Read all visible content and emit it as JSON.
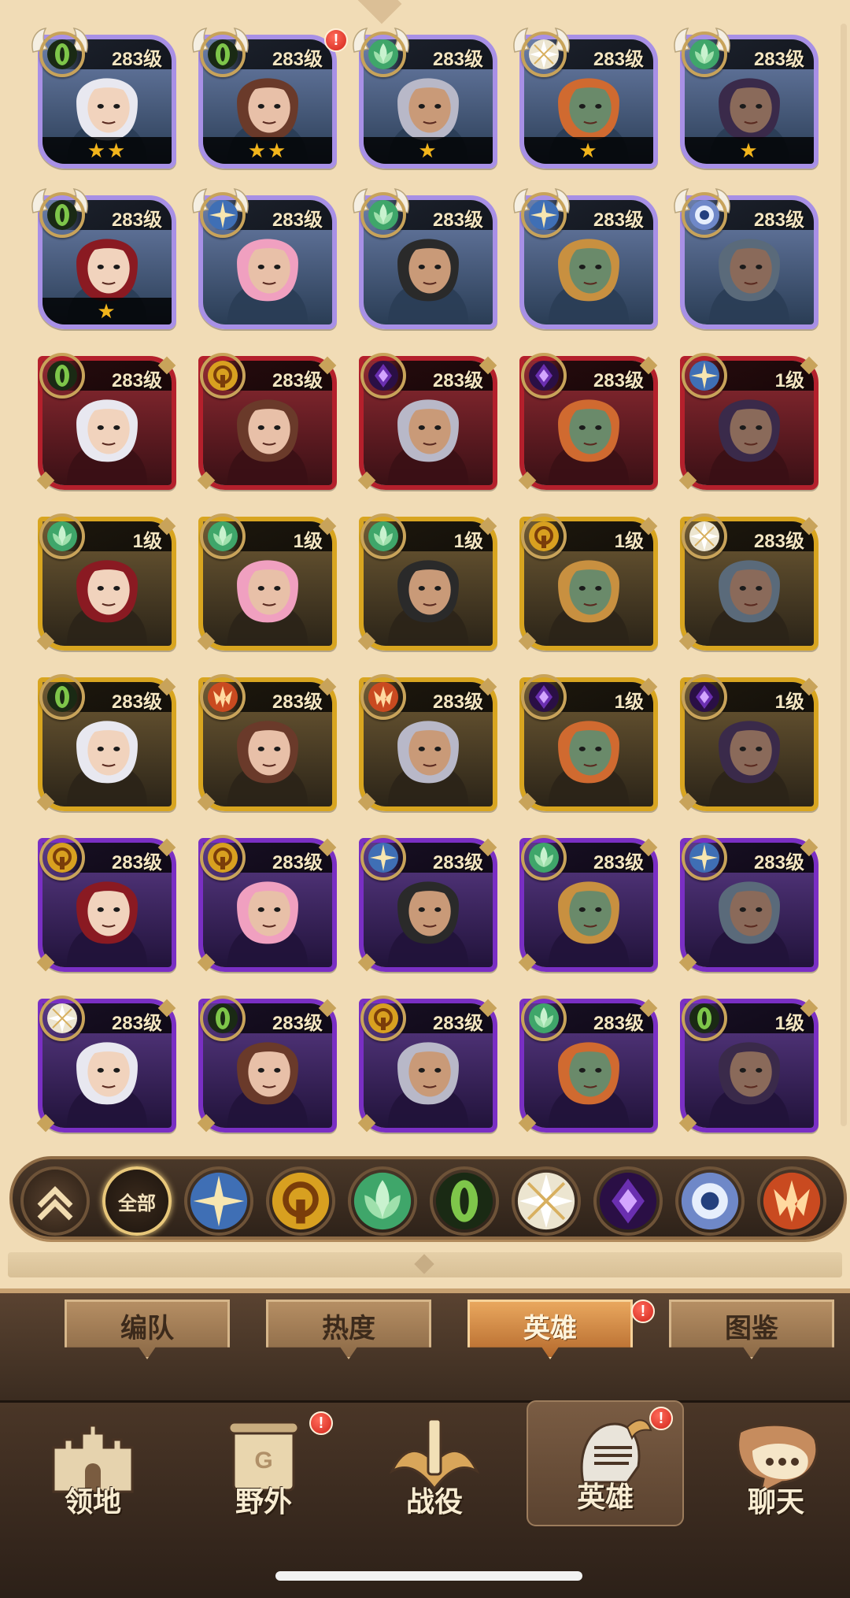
{
  "heroes": [
    {
      "level": "283级",
      "faction": "graveborn",
      "tier": "purple",
      "stars": "★★",
      "wings": true,
      "alert": false
    },
    {
      "level": "283级",
      "faction": "graveborn",
      "tier": "purple",
      "stars": "★★",
      "wings": true,
      "alert": true
    },
    {
      "level": "283级",
      "faction": "wilder",
      "tier": "purple",
      "stars": "★",
      "wings": true,
      "alert": false
    },
    {
      "level": "283级",
      "faction": "celestial",
      "tier": "purple",
      "stars": "★",
      "wings": true,
      "alert": false
    },
    {
      "level": "283级",
      "faction": "wilder",
      "tier": "purple",
      "stars": "★",
      "wings": true,
      "alert": false
    },
    {
      "level": "283级",
      "faction": "graveborn",
      "tier": "purple",
      "stars": "★",
      "wings": true,
      "alert": false
    },
    {
      "level": "283级",
      "faction": "lightbearer",
      "tier": "purple",
      "stars": "",
      "wings": true,
      "alert": false
    },
    {
      "level": "283级",
      "faction": "wilder",
      "tier": "purple",
      "stars": "",
      "wings": true,
      "alert": false
    },
    {
      "level": "283级",
      "faction": "lightbearer",
      "tier": "purple",
      "stars": "",
      "wings": true,
      "alert": false
    },
    {
      "level": "283级",
      "faction": "dimensional",
      "tier": "purple",
      "stars": "",
      "wings": true,
      "alert": false
    },
    {
      "level": "283级",
      "faction": "graveborn",
      "tier": "red",
      "stars": "",
      "wings": false,
      "alert": false
    },
    {
      "level": "283级",
      "faction": "mauler",
      "tier": "red",
      "stars": "",
      "wings": false,
      "alert": false
    },
    {
      "level": "283级",
      "faction": "hypogean",
      "tier": "red",
      "stars": "",
      "wings": false,
      "alert": false
    },
    {
      "level": "283级",
      "faction": "hypogean",
      "tier": "red",
      "stars": "",
      "wings": false,
      "alert": false
    },
    {
      "level": "1级",
      "faction": "lightbearer",
      "tier": "red",
      "stars": "",
      "wings": false,
      "alert": false
    },
    {
      "level": "1级",
      "faction": "wilder",
      "tier": "gold",
      "stars": "",
      "wings": false,
      "alert": false
    },
    {
      "level": "1级",
      "faction": "wilder",
      "tier": "gold",
      "stars": "",
      "wings": false,
      "alert": false
    },
    {
      "level": "1级",
      "faction": "wilder",
      "tier": "gold",
      "stars": "",
      "wings": false,
      "alert": false
    },
    {
      "level": "1级",
      "faction": "mauler",
      "tier": "gold",
      "stars": "",
      "wings": false,
      "alert": false
    },
    {
      "level": "283级",
      "faction": "celestial",
      "tier": "gold",
      "stars": "",
      "wings": false,
      "alert": false
    },
    {
      "level": "283级",
      "faction": "graveborn",
      "tier": "gold",
      "stars": "",
      "wings": false,
      "alert": false
    },
    {
      "level": "283级",
      "faction": "draconis",
      "tier": "gold",
      "stars": "",
      "wings": false,
      "alert": false
    },
    {
      "level": "283级",
      "faction": "draconis",
      "tier": "gold",
      "stars": "",
      "wings": false,
      "alert": false
    },
    {
      "level": "1级",
      "faction": "hypogean",
      "tier": "gold",
      "stars": "",
      "wings": false,
      "alert": false
    },
    {
      "level": "1级",
      "faction": "hypogean",
      "tier": "gold",
      "stars": "",
      "wings": false,
      "alert": false
    },
    {
      "level": "283级",
      "faction": "mauler",
      "tier": "violet",
      "stars": "",
      "wings": false,
      "alert": false
    },
    {
      "level": "283级",
      "faction": "mauler",
      "tier": "violet",
      "stars": "",
      "wings": false,
      "alert": false
    },
    {
      "level": "283级",
      "faction": "lightbearer",
      "tier": "violet",
      "stars": "",
      "wings": false,
      "alert": false
    },
    {
      "level": "283级",
      "faction": "wilder",
      "tier": "violet",
      "stars": "",
      "wings": false,
      "alert": false
    },
    {
      "level": "283级",
      "faction": "lightbearer",
      "tier": "violet",
      "stars": "",
      "wings": false,
      "alert": false
    },
    {
      "level": "283级",
      "faction": "celestial",
      "tier": "violet",
      "stars": "",
      "wings": false,
      "alert": false
    },
    {
      "level": "283级",
      "faction": "graveborn",
      "tier": "violet",
      "stars": "",
      "wings": false,
      "alert": false
    },
    {
      "level": "283级",
      "faction": "mauler",
      "tier": "violet",
      "stars": "",
      "wings": false,
      "alert": false
    },
    {
      "level": "283级",
      "faction": "wilder",
      "tier": "violet",
      "stars": "",
      "wings": false,
      "alert": false
    },
    {
      "level": "1级",
      "faction": "graveborn",
      "tier": "violet",
      "stars": "",
      "wings": false,
      "alert": false
    }
  ],
  "filter": {
    "all_label": "全部",
    "factions": [
      "lightbearer",
      "mauler",
      "wilder",
      "graveborn",
      "celestial",
      "hypogean",
      "dimensional",
      "draconis"
    ]
  },
  "subtabs": [
    {
      "label": "编队",
      "active": false,
      "alert": false
    },
    {
      "label": "热度",
      "active": false,
      "alert": false
    },
    {
      "label": "英雄",
      "active": true,
      "alert": true
    },
    {
      "label": "图鉴",
      "active": false,
      "alert": false
    }
  ],
  "bottom_nav": [
    {
      "label": "领地",
      "icon": "castle-icon",
      "active": false,
      "alert": false
    },
    {
      "label": "野外",
      "icon": "scroll-map-icon",
      "active": false,
      "alert": true
    },
    {
      "label": "战役",
      "icon": "sword-emblem-icon",
      "active": false,
      "alert": false
    },
    {
      "label": "英雄",
      "icon": "knight-helmet-icon",
      "active": true,
      "alert": true
    },
    {
      "label": "聊天",
      "icon": "chat-bubble-icon",
      "active": false,
      "alert": false
    }
  ],
  "alert_glyph": "!",
  "colors": {
    "lightbearer": "#3f6fb5",
    "mauler": "#d8a020",
    "wilder": "#3fa66a",
    "graveborn": "#2f5a2a",
    "celestial": "#ece5d0",
    "hypogean": "#6a2fb0",
    "dimensional": "#6f88c8",
    "draconis": "#c94a20"
  }
}
